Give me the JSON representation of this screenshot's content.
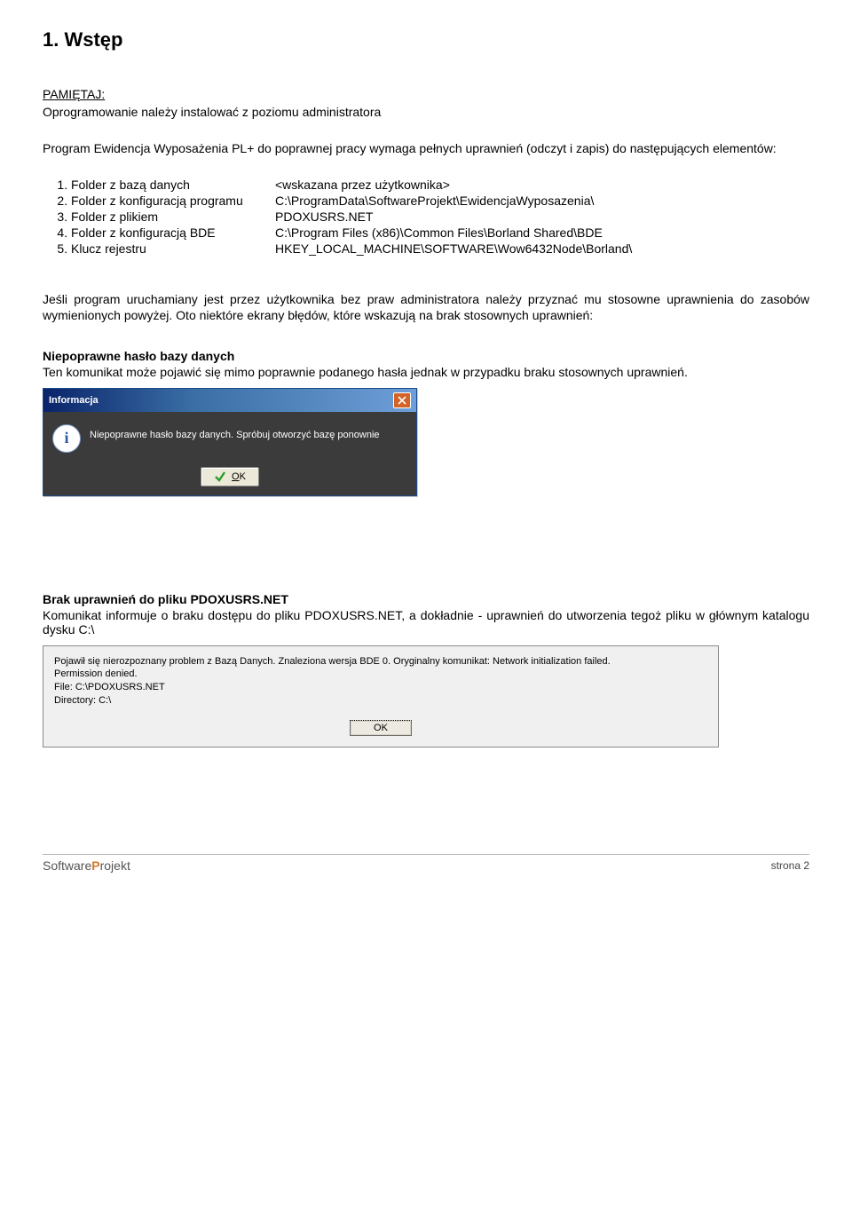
{
  "section": {
    "title": "1. Wstęp"
  },
  "remember": {
    "label": "PAMIĘTAJ:",
    "text": "Oprogramowanie należy instalować z poziomu administratora"
  },
  "intro": "Program Ewidencja Wyposażenia PL+ do poprawnej pracy wymaga pełnych uprawnień (odczyt i zapis) do następujących elementów:",
  "list": [
    {
      "left": "Folder z bazą danych",
      "right": "<wskazana przez użytkownika>"
    },
    {
      "left": "Folder z konfiguracją programu",
      "right": "C:\\ProgramData\\SoftwareProjekt\\EwidencjaWyposazenia\\"
    },
    {
      "left": "Folder z plikiem",
      "right": "PDOXUSRS.NET"
    },
    {
      "left": "Folder z konfiguracją BDE",
      "right": "C:\\Program Files (x86)\\Common Files\\Borland Shared\\BDE"
    },
    {
      "left": "Klucz rejestru",
      "right": "HKEY_LOCAL_MACHINE\\SOFTWARE\\Wow6432Node\\Borland\\"
    }
  ],
  "para2": "Jeśli program uruchamiany jest przez użytkownika bez praw administratora należy przyznać mu stosowne uprawnienia do zasobów wymienionych powyżej. Oto niektóre ekrany błędów, które wskazują na brak stosownych uprawnień:",
  "err1": {
    "heading": "Niepoprawne hasło bazy danych",
    "desc": "Ten komunikat może pojawić się mimo poprawnie podanego hasła jednak w przypadku braku stosownych uprawnień.",
    "dialog": {
      "title": "Informacja",
      "message": "Niepoprawne hasło bazy danych. Spróbuj otworzyć bazę ponownie",
      "ok_label": "OK"
    }
  },
  "err2": {
    "heading": "Brak uprawnień do pliku PDOXUSRS.NET",
    "desc": "Komunikat informuje o braku dostępu do pliku PDOXUSRS.NET, a dokładnie - uprawnień do utworzenia tegoż pliku w głównym katalogu dysku C:\\",
    "dialog": {
      "line1": "Pojawił się nierozpoznany problem z Bazą Danych. Znaleziona wersja BDE 0. Oryginalny komunikat: Network initialization failed.",
      "line2": "Permission denied.",
      "line3": "File: C:\\PDOXUSRS.NET",
      "line4": "Directory: C:\\",
      "ok_label": "OK"
    }
  },
  "footer": {
    "logo_left": "Software",
    "logo_p": "P",
    "logo_right": "rojekt",
    "page": "strona 2"
  }
}
